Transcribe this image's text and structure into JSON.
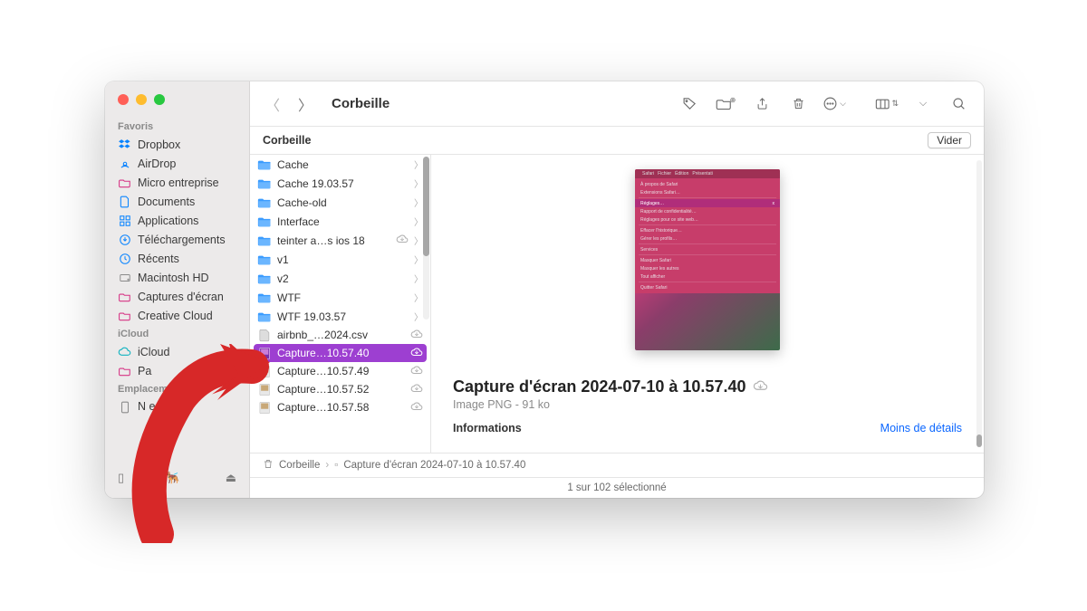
{
  "window_title": "Corbeille",
  "subheader": {
    "title": "Corbeille",
    "empty_label": "Vider"
  },
  "sidebar": {
    "sections": [
      {
        "title": "Favoris",
        "items": [
          {
            "icon": "dropbox",
            "label": "Dropbox",
            "color": "#0a84ff"
          },
          {
            "icon": "airdrop",
            "label": "AirDrop",
            "color": "#0a84ff"
          },
          {
            "icon": "folder",
            "label": "Micro entreprise",
            "color": "#d63384"
          },
          {
            "icon": "doc",
            "label": "Documents",
            "color": "#0a84ff"
          },
          {
            "icon": "apps",
            "label": "Applications",
            "color": "#0a84ff"
          },
          {
            "icon": "download",
            "label": "Téléchargements",
            "color": "#0a84ff"
          },
          {
            "icon": "clock",
            "label": "Récents",
            "color": "#0a84ff"
          },
          {
            "icon": "disk",
            "label": "Macintosh HD",
            "color": "#8a8a8a"
          },
          {
            "icon": "folder",
            "label": "Captures d'écran",
            "color": "#d63384"
          },
          {
            "icon": "folder",
            "label": "Creative Cloud",
            "color": "#d63384"
          }
        ]
      },
      {
        "title": "iCloud",
        "items": [
          {
            "icon": "cloud",
            "label": "iCloud",
            "color": "#12b3c0"
          },
          {
            "icon": "folder",
            "label": "Pa",
            "color": "#d63384"
          }
        ]
      },
      {
        "title": "Emplacements",
        "items": [
          {
            "icon": "phone",
            "label": "N      e 👤",
            "color": "#8a8a8a"
          }
        ]
      }
    ]
  },
  "column_items": [
    {
      "type": "folder",
      "name": "Cache",
      "chev": true
    },
    {
      "type": "folder",
      "name": "Cache 19.03.57",
      "chev": true
    },
    {
      "type": "folder",
      "name": "Cache-old",
      "chev": true
    },
    {
      "type": "folder",
      "name": "Interface",
      "chev": true
    },
    {
      "type": "folder",
      "name": "teinter a…s ios 18",
      "chev": true,
      "cloud": true
    },
    {
      "type": "folder",
      "name": "v1",
      "chev": true
    },
    {
      "type": "folder",
      "name": "v2",
      "chev": true
    },
    {
      "type": "folder",
      "name": "WTF",
      "chev": true
    },
    {
      "type": "folder",
      "name": "WTF 19.03.57",
      "chev": true
    },
    {
      "type": "file",
      "name": "airbnb_…2024.csv",
      "cloud": true
    },
    {
      "type": "image",
      "name": "Capture…10.57.40",
      "cloud": true,
      "selected": true
    },
    {
      "type": "image",
      "name": "Capture…10.57.49",
      "cloud": true
    },
    {
      "type": "image",
      "name": "Capture…10.57.52",
      "cloud": true
    },
    {
      "type": "image",
      "name": "Capture…10.57.58",
      "cloud": true
    }
  ],
  "preview": {
    "title": "Capture d'écran 2024-07-10 à 10.57.40",
    "subtitle": "Image PNG - 91 ko",
    "info_header": "Informations",
    "less_details": "Moins de détails",
    "thumb_menu": {
      "bar": [
        "Safari",
        "Fichier",
        "Édition",
        "Présentati"
      ],
      "items": [
        "À propos de Safari",
        "Extensions Safari…",
        "Réglages…",
        "Rapport de confidentialité…",
        "Réglages pour ce site web…",
        "Effacer l'historique…",
        "Gérer les profils…",
        "Services",
        "Masquer Safari",
        "Masquer les autres",
        "Tout afficher",
        "Quitter Safari"
      ],
      "highlighted_index": 2
    }
  },
  "pathbar": {
    "location": "Corbeille",
    "filename": "Capture d'écran 2024-07-10 à 10.57.40"
  },
  "statusbar": "1 sur 102 sélectionné"
}
